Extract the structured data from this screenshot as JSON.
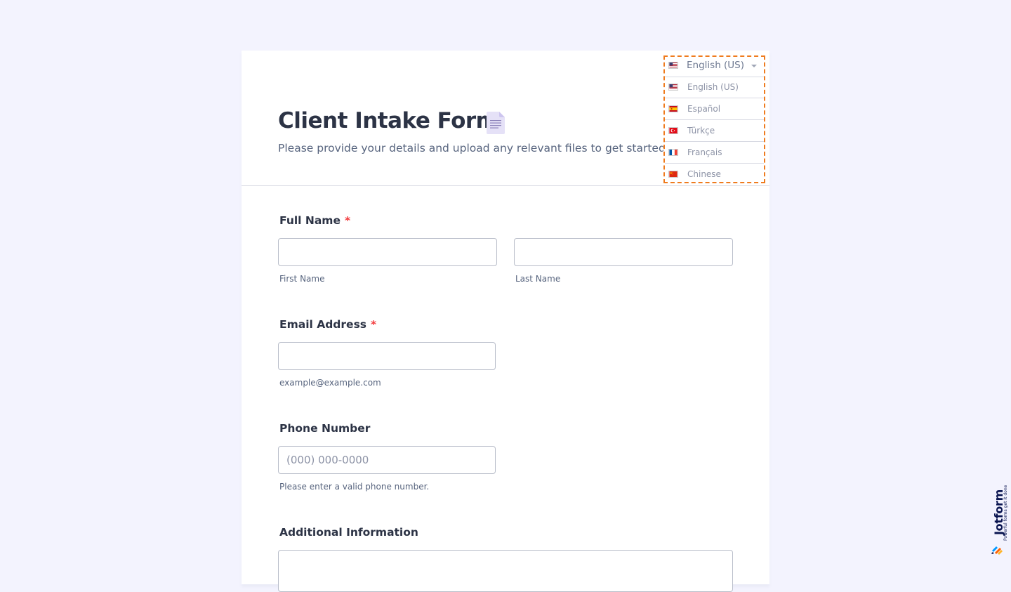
{
  "form": {
    "title": "Client Intake Form",
    "subtitle": "Please provide your details and upload any relevant files to get started."
  },
  "language": {
    "selected": "English (US)",
    "options": [
      {
        "label": "English (US)",
        "flag": "us-flag"
      },
      {
        "label": "Español",
        "flag": "es-flag"
      },
      {
        "label": "Türkçe",
        "flag": "tr-flag"
      },
      {
        "label": "Français",
        "flag": "fr-flag"
      },
      {
        "label": "Chinese",
        "flag": "cn-flag"
      }
    ]
  },
  "fields": {
    "full_name": {
      "label": "Full Name",
      "required_mark": "*",
      "first_value": "",
      "last_value": "",
      "first_sublabel": "First Name",
      "last_sublabel": "Last Name"
    },
    "email": {
      "label": "Email Address",
      "required_mark": "*",
      "value": "",
      "sublabel": "example@example.com"
    },
    "phone": {
      "label": "Phone Number",
      "placeholder": "(000) 000-0000",
      "value": "",
      "sublabel": "Please enter a valid phone number."
    },
    "additional": {
      "label": "Additional Information",
      "value": ""
    }
  },
  "badge": {
    "brand": "Jotform",
    "tagline": "Powerful forms get it done"
  },
  "colors": {
    "background": "#f3f3fe",
    "highlight": "#ef7b1e",
    "required": "#f23a3c",
    "text": "#2c3345"
  }
}
